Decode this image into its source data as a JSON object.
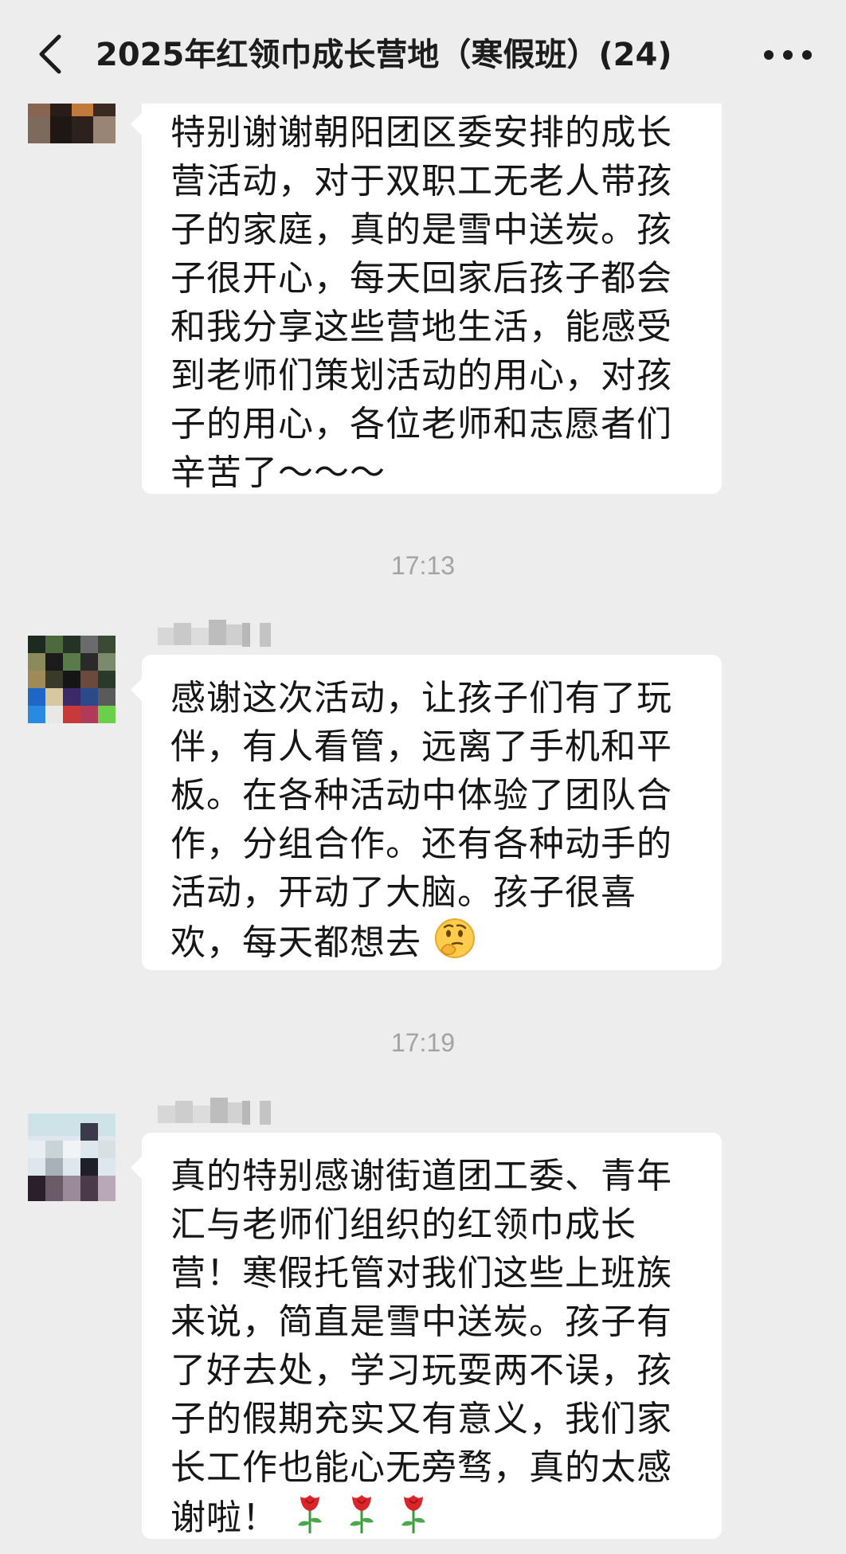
{
  "header": {
    "back_icon": "chevron-left-icon",
    "title": "2025年红领巾成长营地（寒假班）(24)",
    "more_icon": "more-dots-icon"
  },
  "messages": [
    {
      "text": "特别谢谢朝阳团区委安排的成长营活动，对于双职工无老人带孩子的家庭，真的是雪中送炭。孩子很开心，每天回家后孩子都会和我分享这些营地生活，能感受到老师们策划活动的用心，对孩子的用心，各位老师和志愿者们辛苦了～～～"
    },
    {
      "timestamp": "17:13",
      "text": "感谢这次活动，让孩子们有了玩伴，有人看管，远离了手机和平板。在各种活动中体验了团队合作，分组合作。还有各种动手的活动，开动了大脑。孩子很喜欢，每天都想去",
      "emoji": "thinking-face-emoji"
    },
    {
      "timestamp": "17:19",
      "text": "真的特别感谢街道团工委、青年汇与老师们组织的红领巾成长营！寒假托管对我们这些上班族来说，简直是雪中送炭。孩子有了好去处，学习玩耍两不误，孩子的假期充实又有意义，我们家长工作也能心无旁骛，真的太感谢啦！",
      "emoji": "rose-emoji"
    }
  ],
  "colors": {
    "background": "#ededed",
    "bubble": "#ffffff",
    "text": "#161616",
    "timestamp": "#a3a3a3"
  }
}
